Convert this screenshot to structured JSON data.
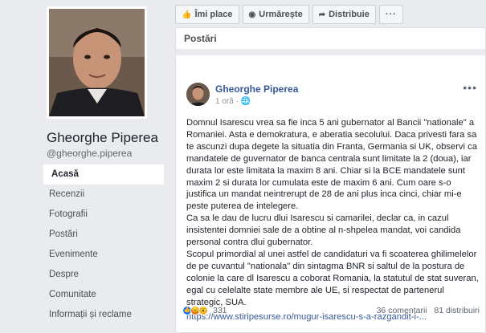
{
  "page": {
    "name": "Gheorghe Piperea",
    "handle": "@gheorghe.piperea"
  },
  "nav": [
    {
      "label": "Acasă",
      "active": true
    },
    {
      "label": "Recenzii"
    },
    {
      "label": "Fotografii"
    },
    {
      "label": "Postări"
    },
    {
      "label": "Evenimente"
    },
    {
      "label": "Despre"
    },
    {
      "label": "Comunitate"
    },
    {
      "label": "Informații și reclame"
    }
  ],
  "actions": {
    "like": "Îmi place",
    "follow": "Urmărește",
    "share": "Distribuie",
    "more": "···"
  },
  "posts_section": {
    "title": "Postări"
  },
  "post": {
    "author": "Gheorghe Piperea",
    "time": "1 oră · ",
    "menu": "•••",
    "paragraphs": [
      "Domnul Isarescu vrea sa fie inca 5 ani gubernator al Bancii \"nationale\" a Romaniei. Asta e demokratura, e aberatia secolului. Daca privesti fara sa te ascunzi dupa degete la situatia din Franta, Germania si UK, observi ca mandatele de guvernator de banca centrala sunt limitate la 2 (doua), iar durata lor este limitata la maxim 8 ani. Chiar si la BCE mandatele sunt maxim 2 si durata lor cumulata este de maxim 6 ani. Cum oare s-o justifica un mandat neintrerupt de 28 de ani plus inca cinci, chiar mi-e peste puterea de intelegere.",
      "Ca sa le dau de lucru dlui Isarescu si camarilei, declar ca, in cazul insistentei domniei sale de a obtine al n-shpelea mandat, voi candida personal contra dlui gubernator.",
      "Scopul primordial al unei astfel de candidaturi va fi scoaterea ghilimelelor de pe cuvantul \"nationala\" din sintagma BNR si saltul de la postura de colonie la care dl Isarescu a coborat Romania, la statutul de stat suveran, egal cu celelalte state membre ale UE, si respectat de partenerul strategic, SUA."
    ],
    "link": "https://www.stiripesurse.ro/mugur-isarescu-s-a-razgandit-i-...",
    "reactions_count": "331",
    "comments": "36 comentarii",
    "shares": "81 distribuiri"
  }
}
